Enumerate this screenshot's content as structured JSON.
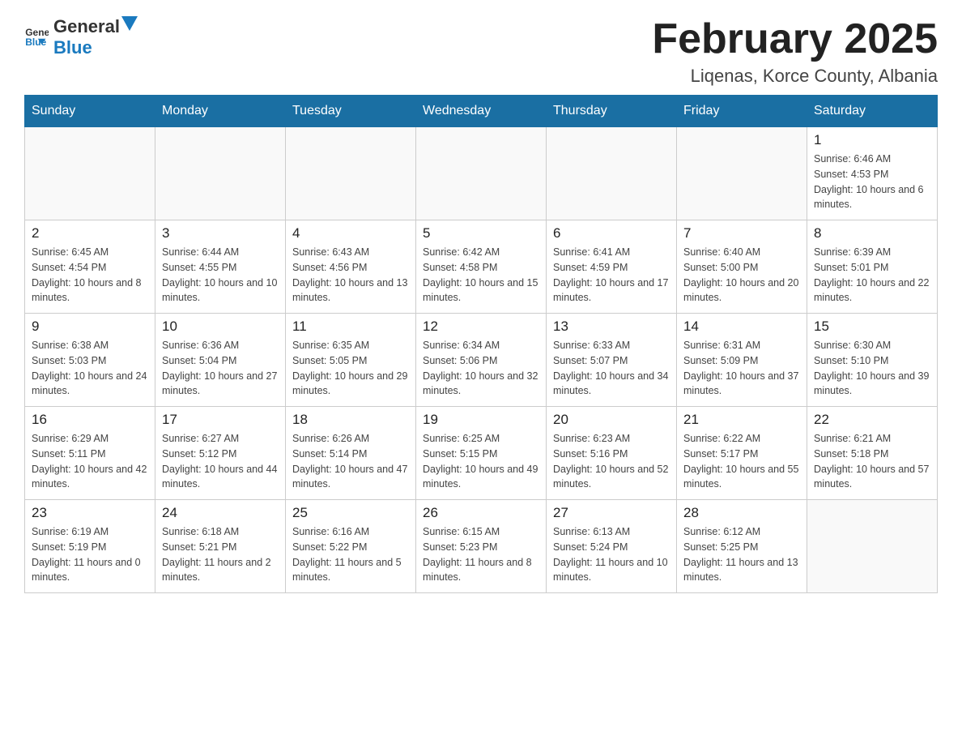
{
  "header": {
    "logo_general": "General",
    "logo_blue": "Blue",
    "month_title": "February 2025",
    "location": "Liqenas, Korce County, Albania"
  },
  "weekdays": [
    "Sunday",
    "Monday",
    "Tuesday",
    "Wednesday",
    "Thursday",
    "Friday",
    "Saturday"
  ],
  "weeks": [
    [
      {
        "day": "",
        "info": ""
      },
      {
        "day": "",
        "info": ""
      },
      {
        "day": "",
        "info": ""
      },
      {
        "day": "",
        "info": ""
      },
      {
        "day": "",
        "info": ""
      },
      {
        "day": "",
        "info": ""
      },
      {
        "day": "1",
        "info": "Sunrise: 6:46 AM\nSunset: 4:53 PM\nDaylight: 10 hours and 6 minutes."
      }
    ],
    [
      {
        "day": "2",
        "info": "Sunrise: 6:45 AM\nSunset: 4:54 PM\nDaylight: 10 hours and 8 minutes."
      },
      {
        "day": "3",
        "info": "Sunrise: 6:44 AM\nSunset: 4:55 PM\nDaylight: 10 hours and 10 minutes."
      },
      {
        "day": "4",
        "info": "Sunrise: 6:43 AM\nSunset: 4:56 PM\nDaylight: 10 hours and 13 minutes."
      },
      {
        "day": "5",
        "info": "Sunrise: 6:42 AM\nSunset: 4:58 PM\nDaylight: 10 hours and 15 minutes."
      },
      {
        "day": "6",
        "info": "Sunrise: 6:41 AM\nSunset: 4:59 PM\nDaylight: 10 hours and 17 minutes."
      },
      {
        "day": "7",
        "info": "Sunrise: 6:40 AM\nSunset: 5:00 PM\nDaylight: 10 hours and 20 minutes."
      },
      {
        "day": "8",
        "info": "Sunrise: 6:39 AM\nSunset: 5:01 PM\nDaylight: 10 hours and 22 minutes."
      }
    ],
    [
      {
        "day": "9",
        "info": "Sunrise: 6:38 AM\nSunset: 5:03 PM\nDaylight: 10 hours and 24 minutes."
      },
      {
        "day": "10",
        "info": "Sunrise: 6:36 AM\nSunset: 5:04 PM\nDaylight: 10 hours and 27 minutes."
      },
      {
        "day": "11",
        "info": "Sunrise: 6:35 AM\nSunset: 5:05 PM\nDaylight: 10 hours and 29 minutes."
      },
      {
        "day": "12",
        "info": "Sunrise: 6:34 AM\nSunset: 5:06 PM\nDaylight: 10 hours and 32 minutes."
      },
      {
        "day": "13",
        "info": "Sunrise: 6:33 AM\nSunset: 5:07 PM\nDaylight: 10 hours and 34 minutes."
      },
      {
        "day": "14",
        "info": "Sunrise: 6:31 AM\nSunset: 5:09 PM\nDaylight: 10 hours and 37 minutes."
      },
      {
        "day": "15",
        "info": "Sunrise: 6:30 AM\nSunset: 5:10 PM\nDaylight: 10 hours and 39 minutes."
      }
    ],
    [
      {
        "day": "16",
        "info": "Sunrise: 6:29 AM\nSunset: 5:11 PM\nDaylight: 10 hours and 42 minutes."
      },
      {
        "day": "17",
        "info": "Sunrise: 6:27 AM\nSunset: 5:12 PM\nDaylight: 10 hours and 44 minutes."
      },
      {
        "day": "18",
        "info": "Sunrise: 6:26 AM\nSunset: 5:14 PM\nDaylight: 10 hours and 47 minutes."
      },
      {
        "day": "19",
        "info": "Sunrise: 6:25 AM\nSunset: 5:15 PM\nDaylight: 10 hours and 49 minutes."
      },
      {
        "day": "20",
        "info": "Sunrise: 6:23 AM\nSunset: 5:16 PM\nDaylight: 10 hours and 52 minutes."
      },
      {
        "day": "21",
        "info": "Sunrise: 6:22 AM\nSunset: 5:17 PM\nDaylight: 10 hours and 55 minutes."
      },
      {
        "day": "22",
        "info": "Sunrise: 6:21 AM\nSunset: 5:18 PM\nDaylight: 10 hours and 57 minutes."
      }
    ],
    [
      {
        "day": "23",
        "info": "Sunrise: 6:19 AM\nSunset: 5:19 PM\nDaylight: 11 hours and 0 minutes."
      },
      {
        "day": "24",
        "info": "Sunrise: 6:18 AM\nSunset: 5:21 PM\nDaylight: 11 hours and 2 minutes."
      },
      {
        "day": "25",
        "info": "Sunrise: 6:16 AM\nSunset: 5:22 PM\nDaylight: 11 hours and 5 minutes."
      },
      {
        "day": "26",
        "info": "Sunrise: 6:15 AM\nSunset: 5:23 PM\nDaylight: 11 hours and 8 minutes."
      },
      {
        "day": "27",
        "info": "Sunrise: 6:13 AM\nSunset: 5:24 PM\nDaylight: 11 hours and 10 minutes."
      },
      {
        "day": "28",
        "info": "Sunrise: 6:12 AM\nSunset: 5:25 PM\nDaylight: 11 hours and 13 minutes."
      },
      {
        "day": "",
        "info": ""
      }
    ]
  ]
}
